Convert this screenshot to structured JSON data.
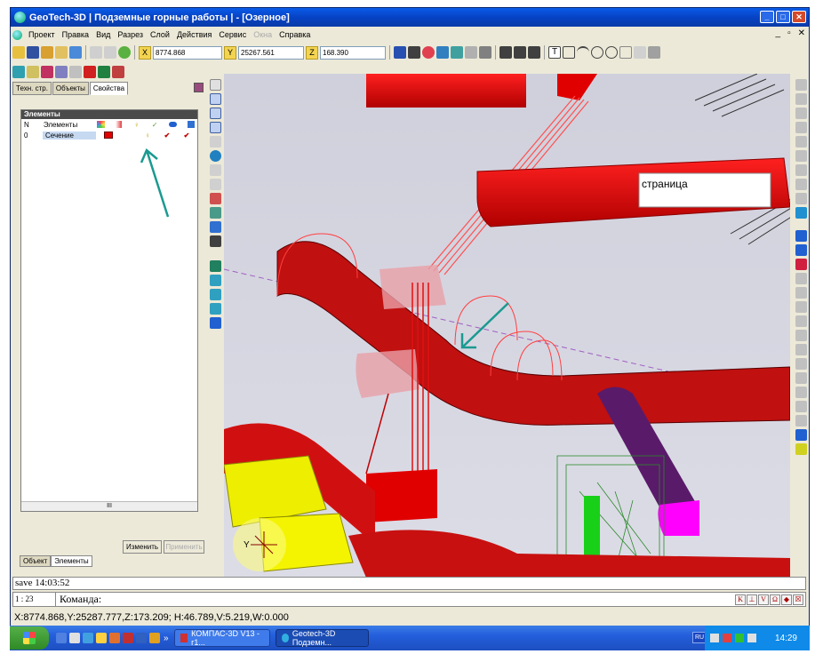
{
  "window": {
    "title": "GeoTech-3D | Подземные горные работы | - [Озерное]"
  },
  "menu": [
    "Проект",
    "Правка",
    "Вид",
    "Разрез",
    "Слой",
    "Действия",
    "Сервис",
    "Окна",
    "Справка"
  ],
  "menu_disabled": "Окна",
  "coords": {
    "x_label": "X",
    "x_value": "8774.868",
    "y_label": "Y",
    "y_value": "25267.561",
    "z_label": "Z",
    "z_value": "168.390"
  },
  "panel": {
    "tabs": [
      "Техн. стр.",
      "Объекты",
      "Свойства"
    ],
    "active_tab": "Свойства",
    "list_header": "Элементы",
    "columns": {
      "n": "N",
      "name": "Элементы"
    },
    "rows": [
      {
        "n": "0",
        "name": "Сечение",
        "color": "#e00000"
      }
    ],
    "buttons": {
      "change": "Изменить",
      "apply": "Применить"
    },
    "bottom_tabs": [
      "Объект",
      "Элементы"
    ]
  },
  "viewport": {
    "label_text": "страница"
  },
  "status": {
    "save_line": "save 14:03:52",
    "cmd_number": "1 : 23",
    "cmd_label": "Команда:",
    "cmd_buttons": [
      "K",
      "⊥",
      "V",
      "Ω",
      "◆",
      "☒"
    ],
    "coord_line": "X:8774.868,Y:25287.777,Z:173.209; H:46.789,V:5.219,W:0.000"
  },
  "taskbar": {
    "tasks": [
      "КОМПАС-3D V13 - г1...",
      "Geotech-3D Подземн..."
    ],
    "lang": "RU",
    "time": "14:29"
  },
  "colors": {
    "tunnel_red": "#e60000",
    "tunnel_yellow": "#f2f200",
    "tunnel_purple": "#6a1c78",
    "magenta_face": "#ff00ff",
    "annotation_arrow": "#1a9a90"
  }
}
